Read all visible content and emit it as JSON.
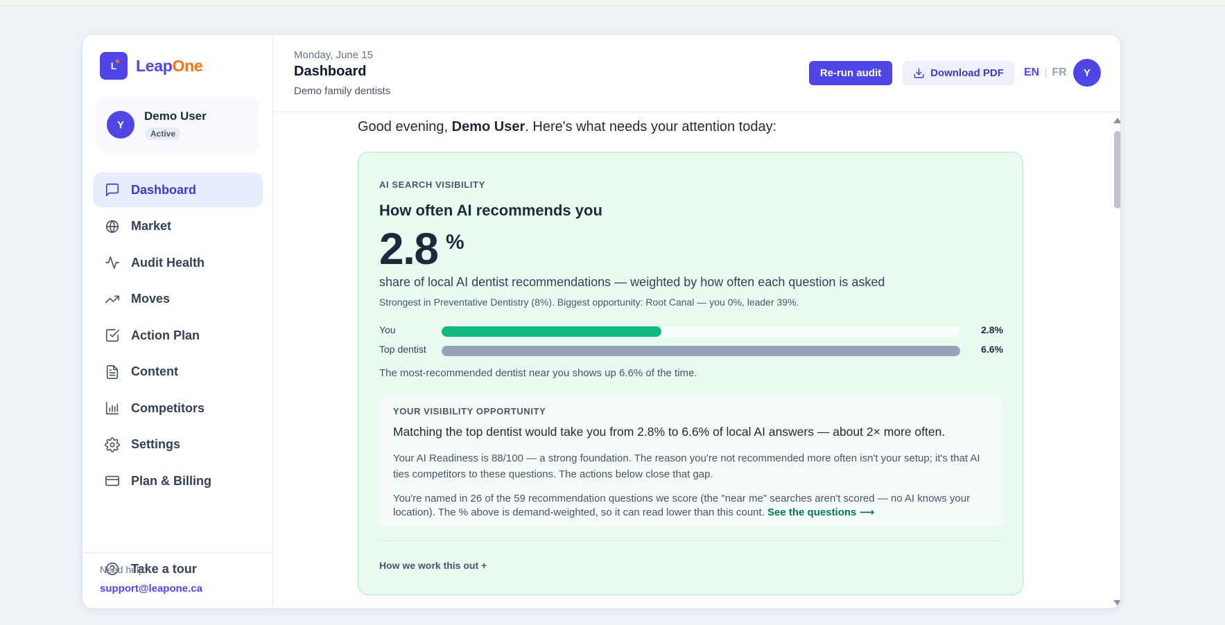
{
  "brand": {
    "mark_letter": "L",
    "name_part1": "Leap",
    "name_part2": "One",
    "accent": "#4f46e5",
    "accent2": "#f97316"
  },
  "user": {
    "initial": "Y",
    "name": "Demo User",
    "status": "Active"
  },
  "sidebar": {
    "items": [
      {
        "label": "Dashboard",
        "icon": "message-square-icon",
        "active": true
      },
      {
        "label": "Market",
        "icon": "globe-icon"
      },
      {
        "label": "Audit Health",
        "icon": "activity-icon"
      },
      {
        "label": "Moves",
        "icon": "trending-up-icon"
      },
      {
        "label": "Action Plan",
        "icon": "check-square-icon"
      },
      {
        "label": "Content",
        "icon": "file-text-icon"
      },
      {
        "label": "Competitors",
        "icon": "bar-chart-icon"
      },
      {
        "label": "Settings",
        "icon": "gear-icon"
      },
      {
        "label": "Plan & Billing",
        "icon": "credit-card-icon"
      }
    ],
    "tour": {
      "label": "Take a tour",
      "icon": "help-circle-icon"
    },
    "help_label": "Need help?",
    "help_email": "support@leapone.ca"
  },
  "header": {
    "date": "Monday, June 15",
    "title": "Dashboard",
    "subtitle": "Demo family dentists",
    "rerun_label": "Re-run audit",
    "pdf_label": "Download PDF",
    "lang_en": "EN",
    "lang_sep": "|",
    "lang_fr": "FR",
    "avatar_initial": "Y"
  },
  "greeting": {
    "prefix": "Good evening, ",
    "name": "Demo User",
    "suffix": ". Here's what needs your attention today:"
  },
  "visibility": {
    "eyebrow": "AI SEARCH VISIBILITY",
    "title": "How often AI recommends you",
    "value": "2.8",
    "unit": "%",
    "description": "share of local AI dentist recommendations — weighted by how often each question is asked",
    "strongest": "Strongest in Preventative Dentistry (8%). Biggest opportunity: Root Canal — you 0%, leader 39%.",
    "bars": [
      {
        "label": "You",
        "value_text": "2.8%",
        "fill_fraction": 0.424,
        "color": "#10b981"
      },
      {
        "label": "Top dentist",
        "value_text": "6.6%",
        "fill_fraction": 1.0,
        "color": "#94a3b8"
      }
    ],
    "most_recommended": "The most-recommended dentist near you shows up 6.6% of the time.",
    "opportunity": {
      "eyebrow": "YOUR VISIBILITY OPPORTUNITY",
      "headline": "Matching the top dentist would take you from 2.8% to 6.6% of local AI answers — about 2× more often.",
      "paragraph1": "Your AI Readiness is 88/100 — a strong foundation. The reason you're not recommended more often isn't your setup; it's that AI ties competitors to these questions. The actions below close that gap.",
      "paragraph2": "You're named in 26 of the 59 recommendation questions we score (the \"near me\" searches aren't scored — no AI knows your location). The % above is demand-weighted, so it can read lower than this count. ",
      "link": "See the questions ⟶"
    },
    "how_label": "How we work this out +"
  }
}
